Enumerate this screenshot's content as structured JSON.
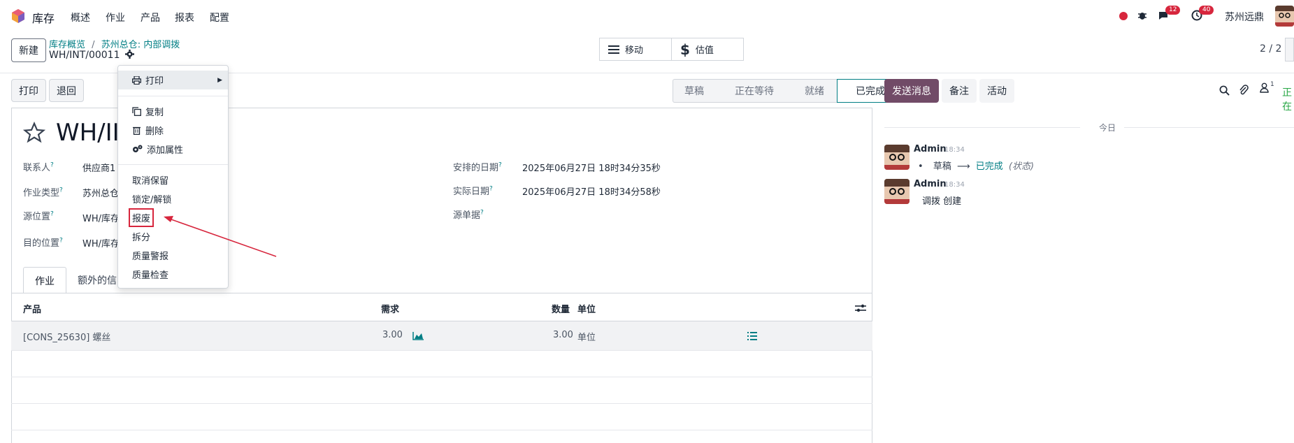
{
  "navbar": {
    "app_name": "库存",
    "menus": [
      "概述",
      "作业",
      "产品",
      "报表",
      "配置"
    ],
    "messages_count": "12",
    "activities_count": "40",
    "company": "苏州远鼎"
  },
  "control": {
    "new_label": "新建",
    "breadcrumb_root": "库存概览",
    "breadcrumb_sep": "/",
    "breadcrumb_current": "苏州总仓: 内部调拨",
    "record_ref": "WH/INT/00011",
    "smart_move": "移动",
    "smart_valuation": "估值",
    "pager": "2 / 2"
  },
  "actions": {
    "print_label": "打印",
    "return_label": "退回"
  },
  "statusbar": [
    "草稿",
    "正在等待",
    "就绪",
    "已完成"
  ],
  "form": {
    "title": "WH/II",
    "contact_label": "联系人",
    "contact_value": "供应商1",
    "op_type_label": "作业类型",
    "op_type_value": "苏州总仓",
    "src_loc_label": "源位置",
    "src_loc_value": "WH/库存",
    "dst_loc_label": "目的位置",
    "dst_loc_value": "WH/库存",
    "scheduled_label": "安排的日期",
    "scheduled_value": "2025年06月27日 18时34分35秒",
    "done_label": "实际日期",
    "done_value": "2025年06月27日 18时34分58秒",
    "origin_label": "源单据",
    "help_mark": "?"
  },
  "tabs": [
    "作业",
    "额外的信"
  ],
  "table": {
    "headers": {
      "product": "产品",
      "demand": "需求",
      "quantity": "数量",
      "uom": "单位"
    },
    "rows": [
      {
        "product": "[CONS_25630] 螺丝",
        "demand": "3.00",
        "quantity": "3.00",
        "uom": "单位"
      }
    ]
  },
  "chatter": {
    "send_message": "发送消息",
    "log_note": "备注",
    "activity": "活动",
    "followers_count": "1",
    "status_extra": "正在",
    "day_separator": "今日",
    "messages": [
      {
        "author": "Admin",
        "time": "18:34",
        "from": "草稿",
        "to": "已完成",
        "field": "(状态)"
      },
      {
        "author": "Admin",
        "time": "18:34",
        "body": "调拨 创建"
      }
    ]
  },
  "dropdown": {
    "print": "打印",
    "duplicate": "复制",
    "delete": "删除",
    "add_property": "添加属性",
    "unreserve": "取消保留",
    "lock_unlock": "锁定/解锁",
    "scrap": "报废",
    "split": "拆分",
    "quality_alert": "质量警报",
    "quality_check": "质量检查"
  },
  "colors": {
    "primary": "#714b67",
    "link": "#017e84",
    "highlight_border": "#d7263d",
    "arrow": "#d7263d"
  }
}
